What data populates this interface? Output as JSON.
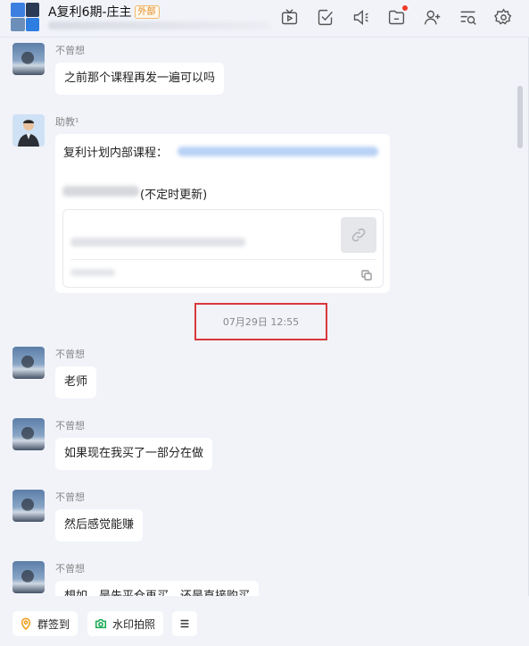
{
  "header": {
    "title": "A复利6期-庄主",
    "badge": "外部"
  },
  "messages": [
    {
      "sender": "不曾想",
      "text": "之前那个课程再发一遍可以吗"
    },
    {
      "sender": "助教¹",
      "card_line1": "复利计划内部课程：",
      "card_line2": "(不定时更新)"
    },
    {
      "sender": "不曾想",
      "text": "老师"
    },
    {
      "sender": "不曾想",
      "text": "如果现在我买了一部分在做"
    },
    {
      "sender": "不曾想",
      "text": "然后感觉能赚"
    },
    {
      "sender": "不曾想",
      "text": "想如，是先平仓再买，还是直接购买"
    }
  ],
  "timestamp": "07月29日 12:55",
  "toolbar": {
    "checkin_label": "群签到",
    "photo_label": "水印拍照"
  },
  "colors": {
    "highlight_border": "#d9373d",
    "badge_orange": "#e08a1e",
    "notification_dot": "#f03a2a"
  }
}
